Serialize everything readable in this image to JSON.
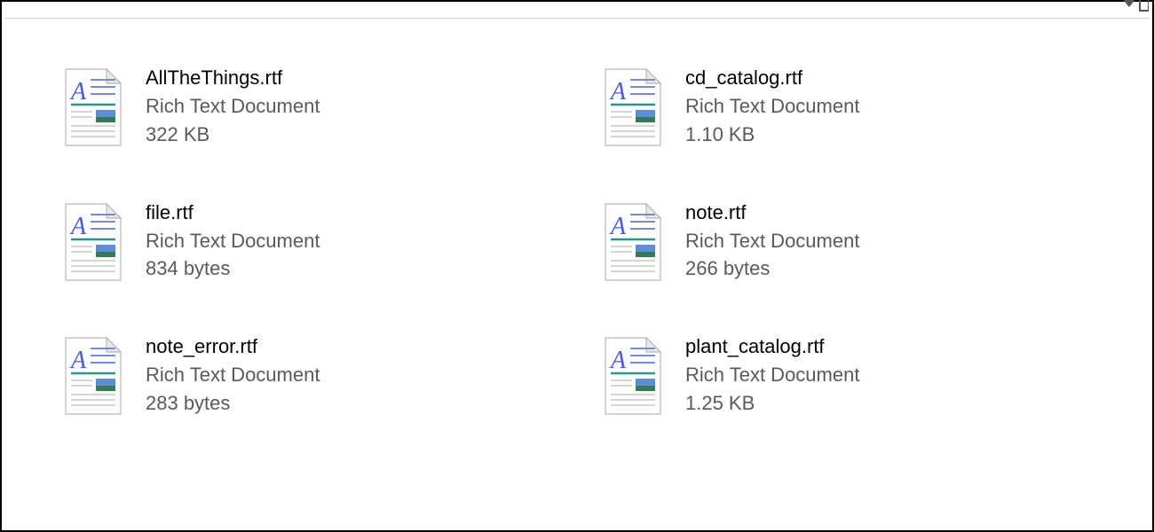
{
  "files": [
    {
      "name": "AllTheThings.rtf",
      "type": "Rich Text Document",
      "size": "322 KB"
    },
    {
      "name": "cd_catalog.rtf",
      "type": "Rich Text Document",
      "size": "1.10 KB"
    },
    {
      "name": "file.rtf",
      "type": "Rich Text Document",
      "size": "834 bytes"
    },
    {
      "name": "note.rtf",
      "type": "Rich Text Document",
      "size": "266 bytes"
    },
    {
      "name": "note_error.rtf",
      "type": "Rich Text Document",
      "size": "283 bytes"
    },
    {
      "name": "plant_catalog.rtf",
      "type": "Rich Text Document",
      "size": "1.25 KB"
    }
  ]
}
